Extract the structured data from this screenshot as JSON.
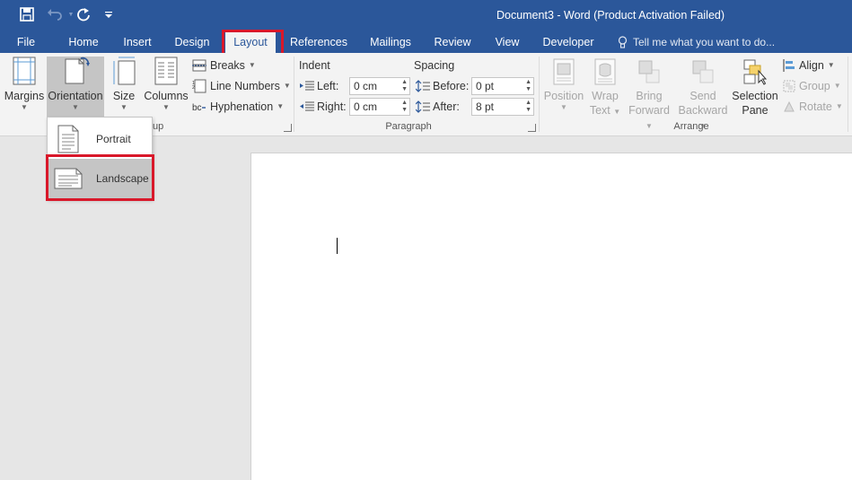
{
  "window": {
    "title": "Document3 - Word (Product Activation Failed)"
  },
  "quick_access": {
    "save_icon": "save-icon",
    "undo_icon": "undo-icon",
    "redo_icon": "redo-icon",
    "customize_icon": "customize-qat-icon"
  },
  "tabs": [
    {
      "label": "File"
    },
    {
      "label": "Home"
    },
    {
      "label": "Insert"
    },
    {
      "label": "Design"
    },
    {
      "label": "Layout"
    },
    {
      "label": "References"
    },
    {
      "label": "Mailings"
    },
    {
      "label": "Review"
    },
    {
      "label": "View"
    },
    {
      "label": "Developer"
    }
  ],
  "tell_me": {
    "placeholder": "Tell me what you want to do..."
  },
  "page_setup": {
    "label": "Page Setup",
    "margins": "Margins",
    "orientation": "Orientation",
    "size": "Size",
    "columns": "Columns",
    "breaks": "Breaks",
    "line_numbers": "Line Numbers",
    "hyphenation": "Hyphenation"
  },
  "paragraph": {
    "label": "Paragraph",
    "indent_title": "Indent",
    "spacing_title": "Spacing",
    "left_label": "Left:",
    "left_value": "0 cm",
    "right_label": "Right:",
    "right_value": "0 cm",
    "before_label": "Before:",
    "before_value": "0 pt",
    "after_label": "After:",
    "after_value": "8 pt"
  },
  "arrange": {
    "label": "Arrange",
    "position_1": "Position",
    "wrap_1": "Wrap",
    "wrap_2": "Text",
    "bring_1": "Bring",
    "bring_2": "Forward",
    "send_1": "Send",
    "send_2": "Backward",
    "selection_1": "Selection",
    "selection_2": "Pane",
    "align": "Align",
    "group": "Group",
    "rotate": "Rotate"
  },
  "orientation_menu": {
    "portrait": "Portrait",
    "landscape": "Landscape",
    "group_label_fragment": "up"
  },
  "colors": {
    "title_bar": "#2b579a",
    "ribbon": "#f3f3f3",
    "highlight": "#d9182a"
  }
}
